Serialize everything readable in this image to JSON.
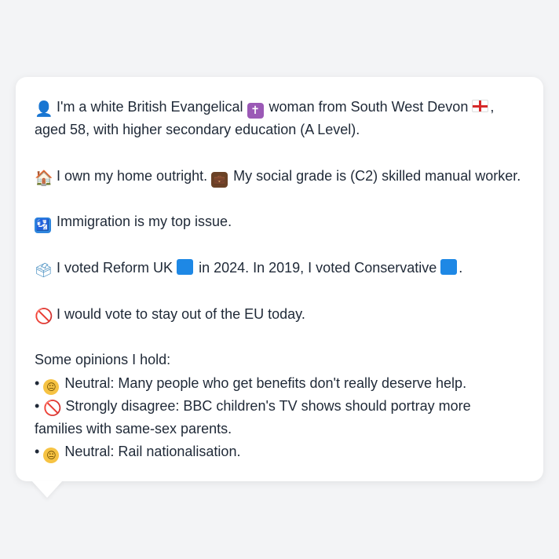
{
  "emoji": {
    "person": "👤",
    "cross": "✝",
    "house": "🏠",
    "briefcase": "💼",
    "passport": "🛂",
    "ballot": "🗳",
    "prohibit": "🚫",
    "neutral": "😐",
    "bullet": "•"
  },
  "profile": {
    "identity_a": " I'm a white British Evangelical ",
    "identity_b": " woman from South West Devon ",
    "identity_c": ",",
    "identity_line2": "aged 58, with higher secondary education (A Level).",
    "home_a": " I own my home outright. ",
    "home_b": " My social grade is (C2) skilled manual worker.",
    "issue": " Immigration is my top issue.",
    "vote_a": " I voted Reform UK ",
    "vote_b": " in 2024. In 2019, I voted Conservative ",
    "vote_c": ".",
    "eu": " I would vote to stay out of the EU today.",
    "opinions_heading": "Some opinions I hold:",
    "opinions": [
      {
        "stance": " Neutral: Many people who get benefits don't really deserve help."
      },
      {
        "stance": " Strongly disagree: BBC children's TV shows should portray more",
        "continuation": "families with same-sex parents."
      },
      {
        "stance": " Neutral: Rail nationalisation."
      }
    ]
  },
  "colors": {
    "background": "#f3f4f6",
    "bubble": "#ffffff",
    "text": "#1f2937",
    "reform": "#1e88e5",
    "conservative": "#1e88e5"
  }
}
